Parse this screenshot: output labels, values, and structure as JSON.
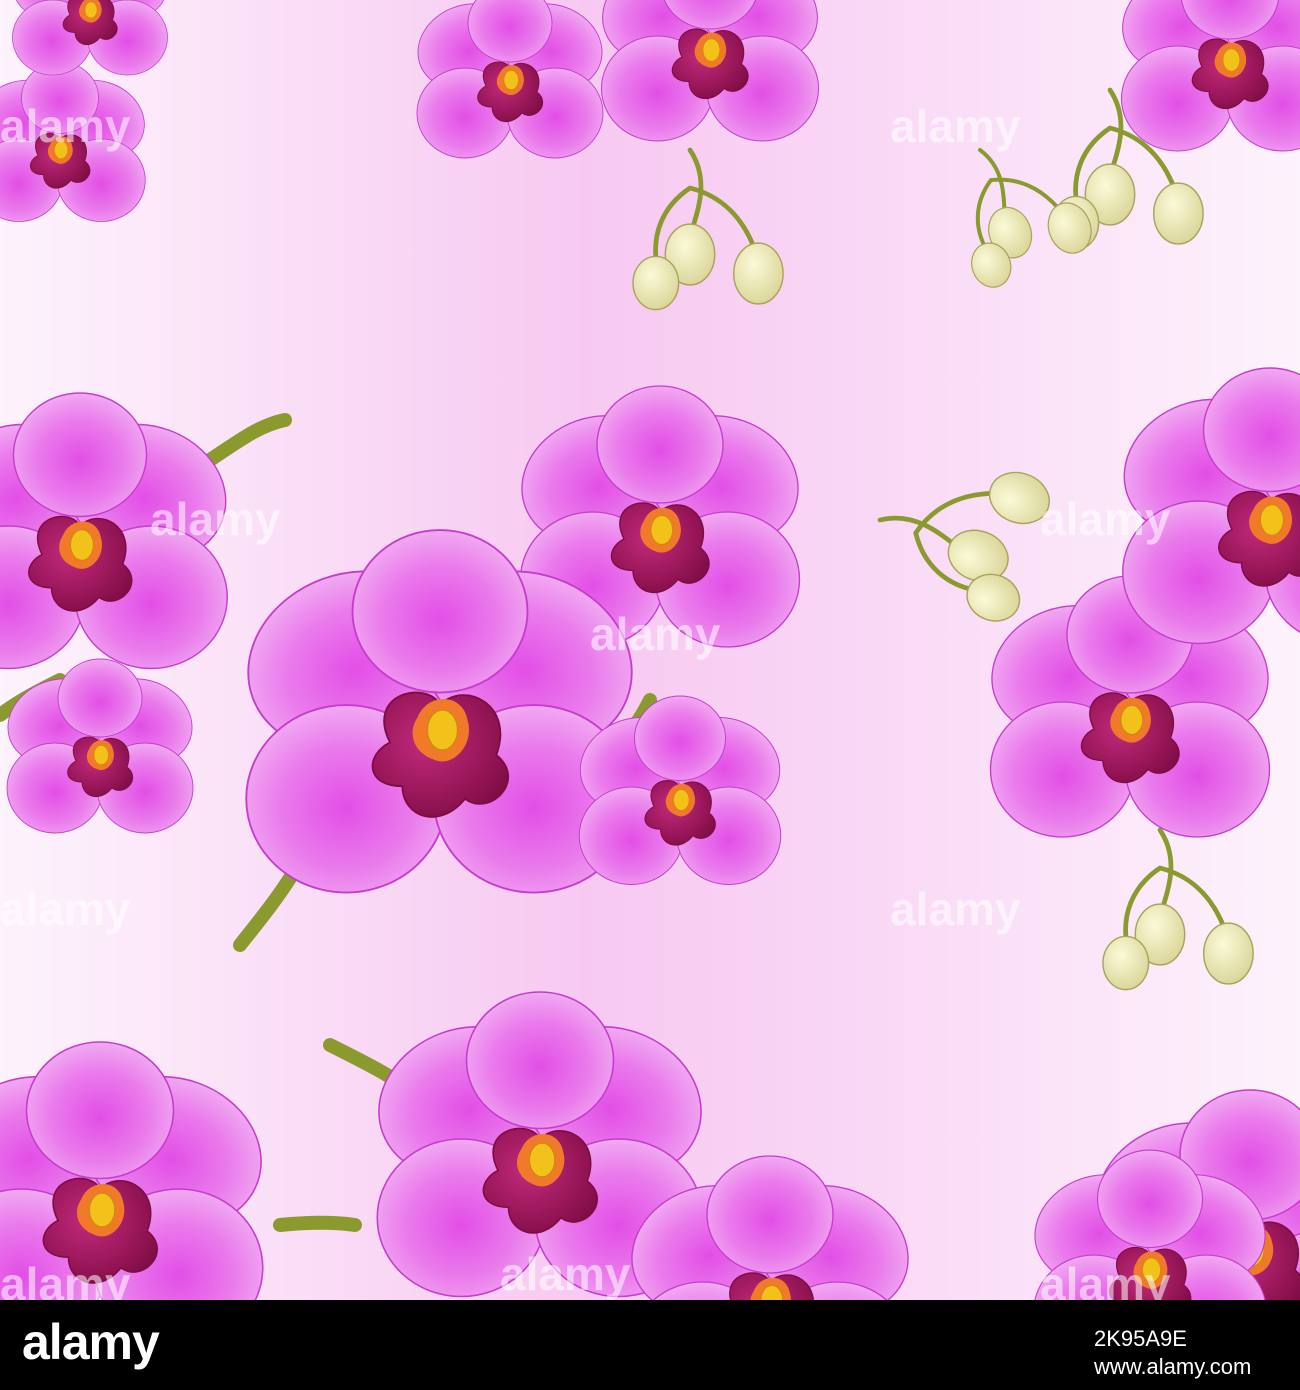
{
  "watermark": {
    "text": "alamy"
  },
  "footer": {
    "logo": "alamy",
    "image_id": "2K95A9E",
    "url": "www.alamy.com"
  },
  "colors": {
    "background_center": "#f7c9f1",
    "background_edge": "#fdf3fc",
    "petal_light": "#f0a6f2",
    "petal_dark": "#e24ee6",
    "petal_outline": "#c63ccc",
    "lip_dark": "#8e0d4e",
    "lip_mid": "#b81e6e",
    "column_orange": "#f07a2a",
    "pollen_yellow": "#f2c21a",
    "stem_green": "#8a9a2e",
    "bud_cream": "#f1efc0"
  },
  "icons": [
    "orchid-flower-icon",
    "orchid-bud-icon"
  ]
}
